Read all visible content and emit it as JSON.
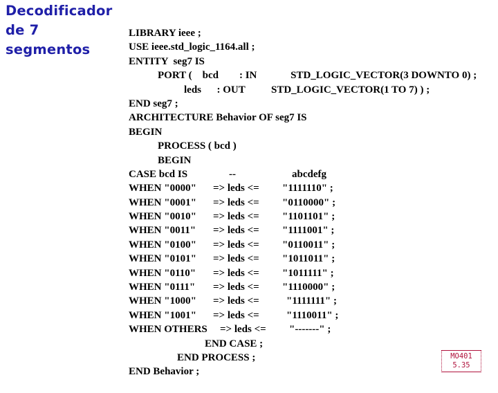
{
  "slide": {
    "title": "Decodificador de 7 segmentos",
    "title_color": "#1f1fa8",
    "background_color": "#ffffff"
  },
  "code": {
    "language": "VHDL",
    "text_color": "#000000",
    "lines": [
      {
        "id": "library",
        "indent": 0,
        "text": "LIBRARY ieee ;"
      },
      {
        "id": "use",
        "indent": 0,
        "text": "USE ieee.std_logic_1164.all ;"
      },
      {
        "id": "entity",
        "indent": 0,
        "text": "ENTITY  seg7 IS"
      },
      {
        "id": "port-bcd",
        "indent": 1,
        "text": "PORT (    bcd        : IN             STD_LOGIC_VECTOR(3 DOWNTO 0) ;"
      },
      {
        "id": "port-leds",
        "indent": 3,
        "text": "leds      : OUT          STD_LOGIC_VECTOR(1 TO 7) ) ;"
      },
      {
        "id": "end-entity",
        "indent": 0,
        "text": "END seg7 ;"
      },
      {
        "id": "architecture",
        "indent": 0,
        "text": "ARCHITECTURE Behavior OF seg7 IS"
      },
      {
        "id": "begin-arch",
        "indent": 0,
        "text": "BEGIN"
      },
      {
        "id": "process",
        "indent": 1,
        "text": "PROCESS ( bcd )"
      },
      {
        "id": "begin-proc",
        "indent": 1,
        "text": "BEGIN"
      }
    ],
    "case_header": {
      "statement": "CASE bcd IS",
      "dash": "--",
      "comment": "abcdefg"
    },
    "case_rows": [
      {
        "when": "WHEN \"0000\"",
        "arrow": "=> leds <=",
        "value": "\"1111110\" ;",
        "nudge": false
      },
      {
        "when": "WHEN \"0001\"",
        "arrow": "=> leds <=",
        "value": "\"0110000\" ;",
        "nudge": false
      },
      {
        "when": "WHEN \"0010\"",
        "arrow": "=> leds <=",
        "value": "\"1101101\" ;",
        "nudge": false
      },
      {
        "when": "WHEN \"0011\"",
        "arrow": "=> leds <=",
        "value": "\"1111001\" ;",
        "nudge": false
      },
      {
        "when": "WHEN \"0100\"",
        "arrow": "=> leds <=",
        "value": "\"0110011\" ;",
        "nudge": false
      },
      {
        "when": "WHEN \"0101\"",
        "arrow": "=> leds <=",
        "value": "\"1011011\" ;",
        "nudge": false
      },
      {
        "when": "WHEN \"0110\"",
        "arrow": "=> leds <=",
        "value": "\"1011111\" ;",
        "nudge": false
      },
      {
        "when": "WHEN \"0111\"",
        "arrow": "=> leds <=",
        "value": "\"1110000\" ;",
        "nudge": false
      },
      {
        "when": "WHEN \"1000\"",
        "arrow": "=> leds <=",
        "value": "\"1111111\" ;",
        "nudge": true
      },
      {
        "when": "WHEN \"1001\"",
        "arrow": "=> leds <=",
        "value": "\"1110011\" ;",
        "nudge": true
      }
    ],
    "others_row": {
      "when": "WHEN OTHERS",
      "arrow": "=> leds <=",
      "value": "\"-------\" ;"
    },
    "closing_lines": [
      {
        "id": "end-case",
        "indent": 4,
        "text": "END CASE ;"
      },
      {
        "id": "end-process",
        "indent": 2,
        "text": "END PROCESS ;"
      },
      {
        "id": "end-behavior",
        "indent": 0,
        "text": "END Behavior ;"
      }
    ]
  },
  "reference_badge": {
    "course": "MO401",
    "number": "5.35",
    "color": "#b0123c"
  }
}
